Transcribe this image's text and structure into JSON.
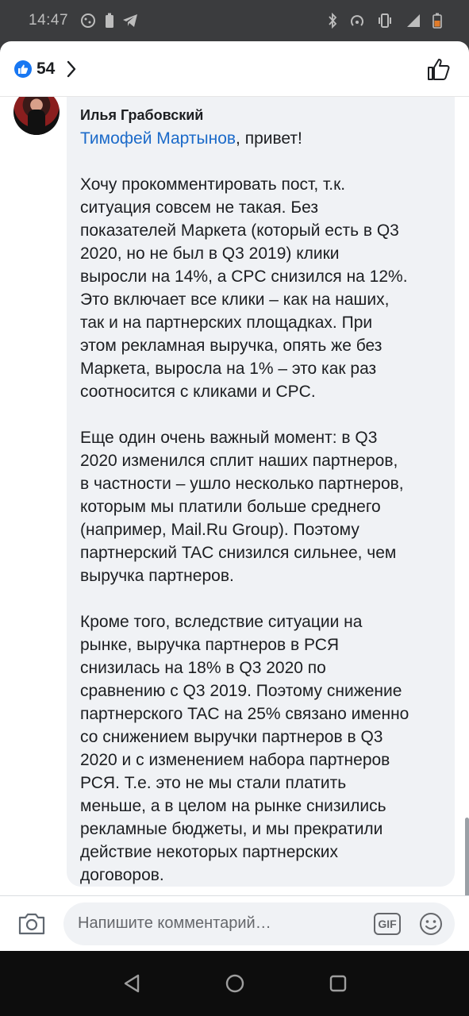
{
  "status_bar": {
    "time": "14:47",
    "icons_left": [
      "cookie-icon",
      "battery-saver-icon",
      "telegram-icon"
    ],
    "icons_right": [
      "bluetooth-icon",
      "hotspot-icon",
      "vibrate-icon",
      "signal-4g-icon",
      "battery-icon"
    ]
  },
  "reactions": {
    "count": "54"
  },
  "comment": {
    "author": "Илья Грабовский",
    "mention": "Тимофей Мартынов",
    "greeting": ", привет!",
    "body": "\n\nХочу прокомментировать пост, т.к.\nситуация совсем не такая. Без\nпоказателей Маркета (который есть в Q3\n2020, но не был в Q3 2019) клики\nвыросли на 14%, а CPC снизился на 12%.\nЭто включает все клики – как на наших,\nтак и на партнерских площадках. При\nэтом рекламная выручка, опять же без\nМаркета, выросла на 1% – это как раз\nсоотносится с кликами и CPC.\n\nЕще один очень важный момент: в Q3\n2020 изменился сплит наших партнеров,\nв частности – ушло несколько партнеров,\nкоторым мы платили больше среднего\n(например, Mail.Ru Group). Поэтому\nпартнерский TAC снизился сильнее, чем\nвыручка партнеров.\n\nКроме того, вследствие ситуации на\nрынке, выручка партнеров в РСЯ\nснизилась на 18% в Q3 2020 по\nсравнению с Q3 2019. Поэтому снижение\nпартнерского TAC на 25% связано именно\nсо снижением выручки партнеров в Q3\n2020 и с изменением набора партнеров\nРСЯ. Т.е. это не мы стали платить\nменьше, а в целом на рынке снизились\nрекламные бюджеты, и мы прекратили\nдействие некоторых партнерских\nдоговоров."
  },
  "composer": {
    "placeholder": "Напишите комментарий…",
    "gif_label": "GIF"
  },
  "colors": {
    "accent": "#1877f2",
    "mention": "#1b6ac9",
    "bubble": "#f0f2f5"
  }
}
